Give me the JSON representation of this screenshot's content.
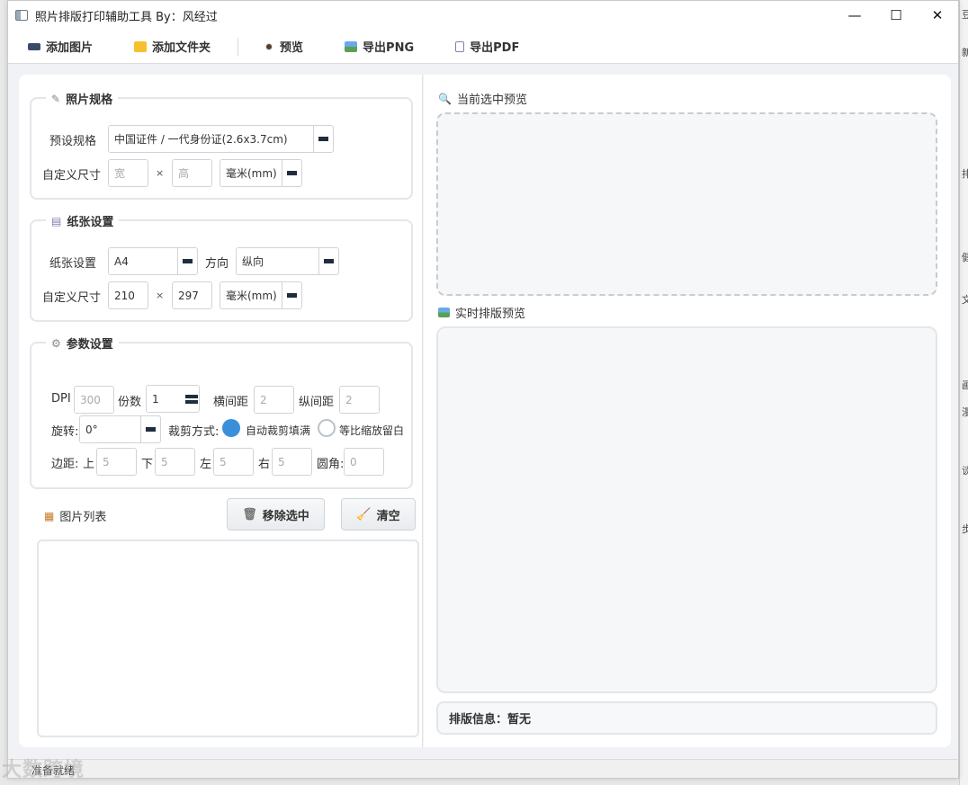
{
  "window": {
    "title": "照片排版打印辅助工具 By：风经过",
    "controls": {
      "minimize": "—",
      "maximize": "☐",
      "close": "✕"
    }
  },
  "toolbar": {
    "add_image": "添加图片",
    "add_folder": "添加文件夹",
    "preview": "预览",
    "export_png": "导出PNG",
    "export_pdf": "导出PDF"
  },
  "photo_spec": {
    "title": "照片规格",
    "preset_label": "预设规格",
    "preset_value": "中国证件 / 一代身份证(2.6x3.7cm)",
    "custom_label": "自定义尺寸",
    "width_placeholder": "宽",
    "times": "×",
    "height_placeholder": "高",
    "unit": "毫米(mm)"
  },
  "paper": {
    "title": "纸张设置",
    "paper_label": "纸张设置",
    "paper_value": "A4",
    "orientation_label": "方向",
    "orientation_value": "纵向",
    "custom_label": "自定义尺寸",
    "width": "210",
    "times": "×",
    "height": "297",
    "unit": "毫米(mm)"
  },
  "params": {
    "title": "参数设置",
    "dpi_label": "DPI",
    "dpi_placeholder": "300",
    "copies_label": "份数",
    "copies_value": "1",
    "hgap_label": "横间距",
    "hgap_placeholder": "2",
    "vgap_label": "纵间距",
    "vgap_placeholder": "2",
    "rotate_label": "旋转:",
    "rotate_value": "0°",
    "crop_label": "裁剪方式:",
    "crop_auto": "自动裁剪填满",
    "crop_fit": "等比缩放留白",
    "margin_label": "边距:",
    "top_label": "上",
    "top_placeholder": "5",
    "bottom_label": "下",
    "bottom_placeholder": "5",
    "left_label": "左",
    "left_placeholder": "5",
    "right_label": "右",
    "right_placeholder": "5",
    "radius_label": "圆角:",
    "radius_placeholder": "0"
  },
  "image_list": {
    "title": "图片列表",
    "remove_btn": "移除选中",
    "clear_btn": "清空"
  },
  "right": {
    "current_preview": "当前选中预览",
    "live_preview": "实时排版预览",
    "info": "排版信息：暂无"
  },
  "status": {
    "text": "准备就绪"
  },
  "watermark": {
    "text": "大数跨境"
  },
  "colors": {
    "accent": "#3a8fdb",
    "panel": "#ffffff",
    "background": "#f0f2f5"
  }
}
